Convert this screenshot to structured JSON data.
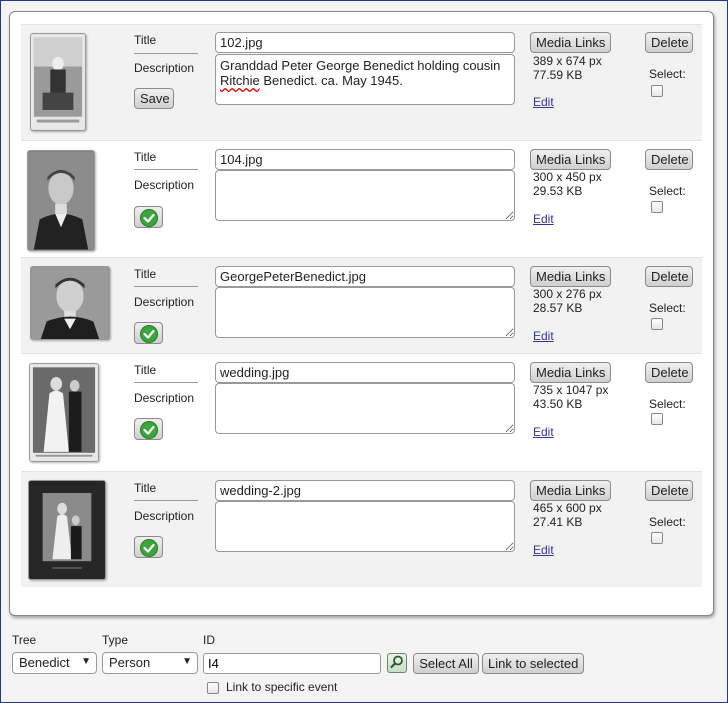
{
  "labels": {
    "title": "Title",
    "description": "Description",
    "save": "Save",
    "media_links": "Media Links",
    "delete": "Delete",
    "select": "Select:",
    "edit": "Edit"
  },
  "items": [
    {
      "title_value": "102.jpg",
      "description_part1": "Granddad Peter George Benedict holding cousin ",
      "description_misspelled": "Ritchie",
      "description_part2": " Benedict.  ca. May 1945.",
      "dimensions": "389 x 674 px",
      "size": "77.59 KB",
      "action": "save"
    },
    {
      "title_value": "104.jpg",
      "description": "",
      "dimensions": "300 x 450 px",
      "size": "29.53 KB",
      "action": "check"
    },
    {
      "title_value": "GeorgePeterBenedict.jpg",
      "description": "",
      "dimensions": "300 x 276 px",
      "size": "28.57 KB",
      "action": "check"
    },
    {
      "title_value": "wedding.jpg",
      "description": "",
      "dimensions": "735 x 1047 px",
      "size": "43.50 KB",
      "action": "check"
    },
    {
      "title_value": "wedding-2.jpg",
      "description": "",
      "dimensions": "465 x 600 px",
      "size": "27.41 KB",
      "action": "check"
    }
  ],
  "link_form": {
    "tree_label": "Tree",
    "tree_value": "Benedict",
    "type_label": "Type",
    "type_value": "Person",
    "id_label": "ID",
    "id_value": "I4",
    "select_all": "Select All",
    "link_to_selected": "Link to selected",
    "link_to_event": "Link to specific event"
  },
  "colors": {
    "check_green": "#3aa63a",
    "link_blue": "#333399",
    "frame_blue": "#1e3a8a"
  }
}
